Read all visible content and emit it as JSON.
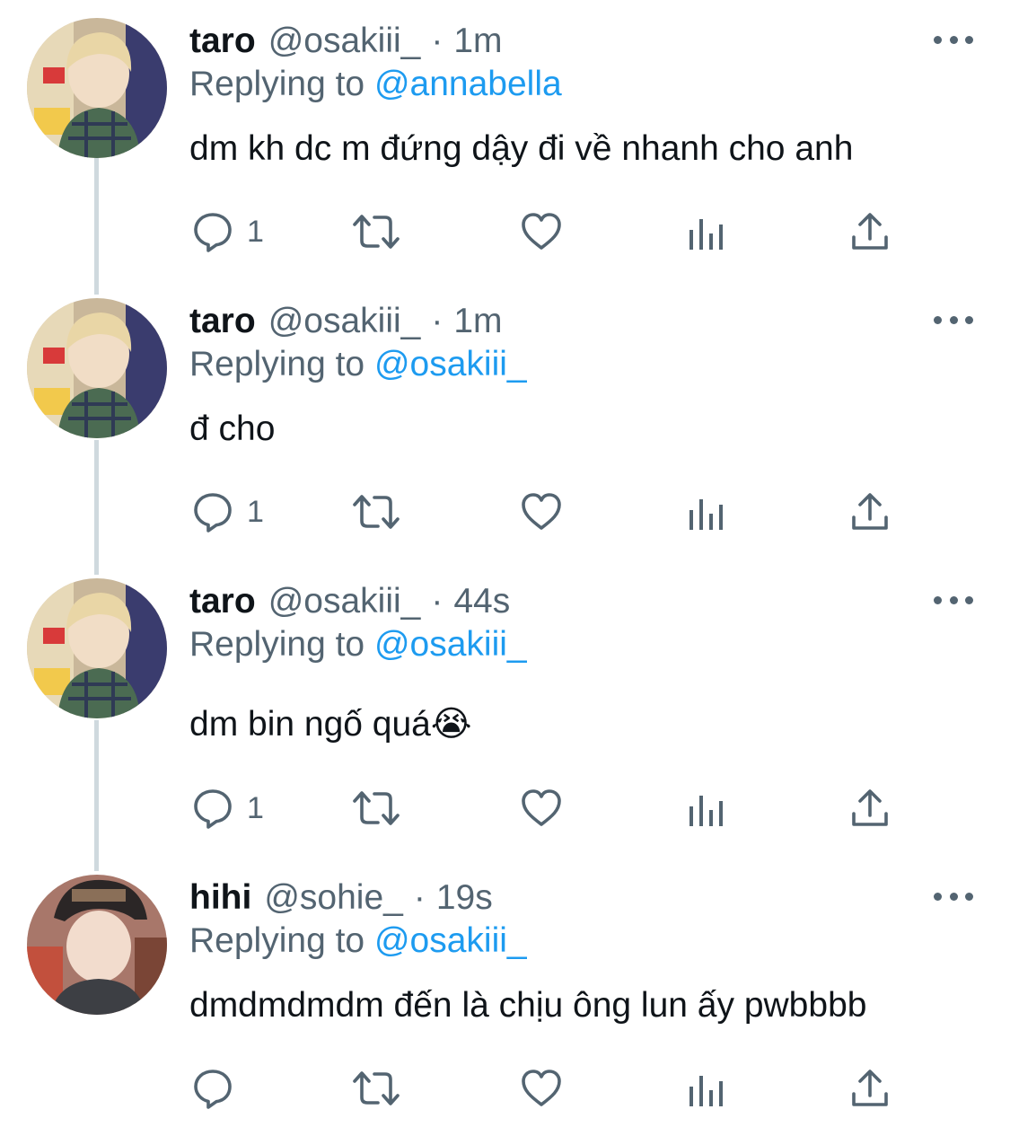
{
  "tweets": [
    {
      "name": "taro",
      "handle": "@osakiii_",
      "separator": "·",
      "time": "1m",
      "replying_prefix": "Replying to ",
      "replying_to": "@annabella",
      "text": "dm kh dc m đứng dậy đi về nhanh cho anh",
      "reply_count": "1"
    },
    {
      "name": "taro",
      "handle": "@osakiii_",
      "separator": "·",
      "time": "1m",
      "replying_prefix": "Replying to ",
      "replying_to": "@osakiii_",
      "text": "đ cho",
      "reply_count": "1"
    },
    {
      "name": "taro",
      "handle": "@osakiii_",
      "separator": "·",
      "time": "44s",
      "replying_prefix": "Replying to ",
      "replying_to": "@osakiii_",
      "text": "dm bin ngố quá😭",
      "reply_count": "1"
    },
    {
      "name": "hihi",
      "handle": "@sohie_",
      "separator": "·",
      "time": "19s",
      "replying_prefix": "Replying to ",
      "replying_to": "@osakiii_",
      "text": "dmdmdmdm đến là chịu ông lun ấy pwbbbb",
      "reply_count": ""
    }
  ],
  "icons": {
    "reply": "reply-icon",
    "retweet": "retweet-icon",
    "like": "heart-icon",
    "analytics": "analytics-icon",
    "share": "share-icon",
    "more": "more-icon"
  },
  "colors": {
    "text": "#0f1419",
    "secondary": "#536471",
    "link": "#1d9bf0",
    "thread_line": "#cfd9de"
  }
}
